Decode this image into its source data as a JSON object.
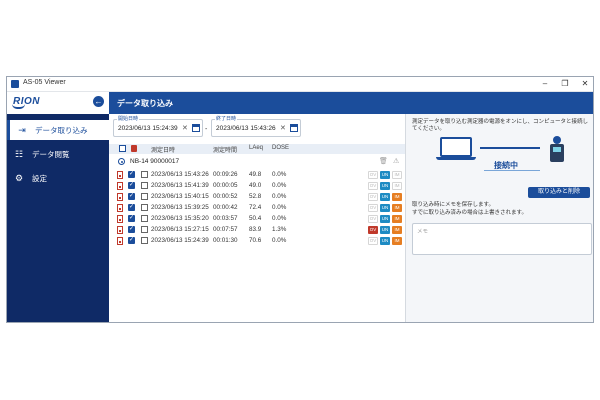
{
  "window": {
    "title": "AS-05 Viewer",
    "controls": [
      "–",
      "❐",
      "✕"
    ]
  },
  "sidebar": {
    "logo": "RION",
    "collapse_icon": "arrow-left-circle-icon",
    "items": [
      {
        "label": "データ取り込み",
        "icon": "import-icon",
        "active": true
      },
      {
        "label": "データ閲覧",
        "icon": "browse-icon",
        "active": false
      },
      {
        "label": "設定",
        "icon": "gear-icon",
        "active": false
      }
    ]
  },
  "header": {
    "title": "データ取り込み"
  },
  "filters": {
    "start": {
      "label": "開始日時",
      "value": "2023/06/13 15:24:39"
    },
    "end": {
      "label": "終了日時",
      "value": "2023/06/13 15:43:26"
    },
    "separator": "-"
  },
  "table": {
    "columns": [
      "測定日時",
      "測定時間",
      "LAeq",
      "DOSE"
    ],
    "group": {
      "label": "NB-14  90000017"
    },
    "rows": [
      {
        "datetime": "2023/06/13 15:43:26",
        "duration": "00:09:26",
        "laeq": "49.8",
        "dose": "0.0%",
        "ov": false,
        "un": true,
        "im": false
      },
      {
        "datetime": "2023/06/13 15:41:39",
        "duration": "00:00:05",
        "laeq": "49.0",
        "dose": "0.0%",
        "ov": false,
        "un": true,
        "im": false
      },
      {
        "datetime": "2023/06/13 15:40:15",
        "duration": "00:00:52",
        "laeq": "52.8",
        "dose": "0.0%",
        "ov": false,
        "un": true,
        "im": true
      },
      {
        "datetime": "2023/06/13 15:39:25",
        "duration": "00:00:42",
        "laeq": "72.4",
        "dose": "0.0%",
        "ov": false,
        "un": true,
        "im": true
      },
      {
        "datetime": "2023/06/13 15:35:20",
        "duration": "00:03:57",
        "laeq": "50.4",
        "dose": "0.0%",
        "ov": false,
        "un": true,
        "im": true
      },
      {
        "datetime": "2023/06/13 15:27:15",
        "duration": "00:07:57",
        "laeq": "83.9",
        "dose": "1.3%",
        "ov": true,
        "un": true,
        "im": true
      },
      {
        "datetime": "2023/06/13 15:24:39",
        "duration": "00:01:30",
        "laeq": "70.6",
        "dose": "0.0%",
        "ov": false,
        "un": true,
        "im": true
      }
    ],
    "badges": {
      "ov": "OV",
      "un": "UN",
      "im": "IM"
    }
  },
  "connection": {
    "instruction": "測定データを取り込む測定器の電源をオンにし、コンピュータと接続してください。",
    "status": "接続中"
  },
  "import": {
    "button": "取り込みと削除",
    "note1": "取り込み時にメモを保存します。",
    "note2": "すでに取り込み済みの場合は上書きされます。",
    "memo_placeholder": "メモ"
  },
  "colors": {
    "navy": "#0f2a66",
    "accent": "#1b4d9b",
    "ov": "#c0392b",
    "un": "#1e8bc3",
    "im": "#e67e22"
  }
}
